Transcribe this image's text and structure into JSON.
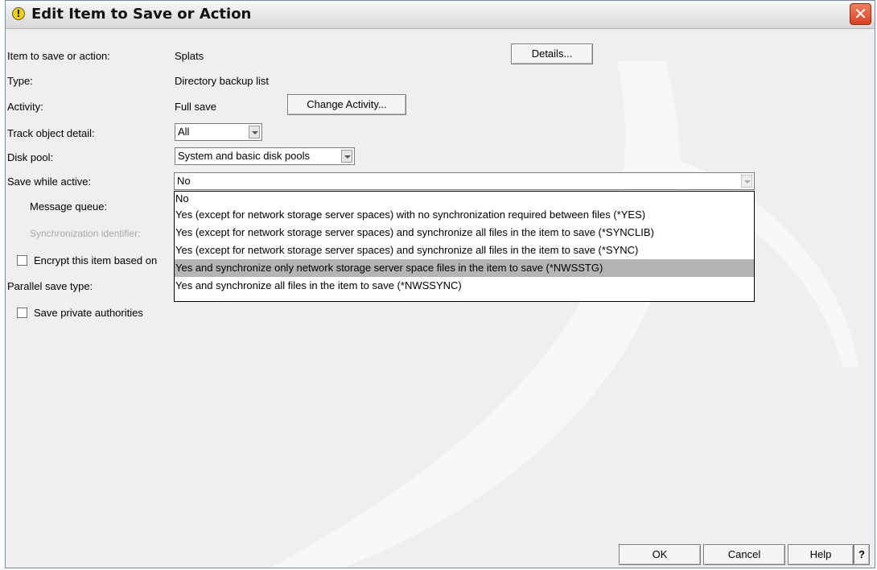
{
  "window": {
    "title": "Edit Item to Save or Action"
  },
  "fields": {
    "item_label": "Item to save or action:",
    "item_value": "Splats",
    "type_label": "Type:",
    "type_value": "Directory backup list",
    "activity_label": "Activity:",
    "activity_value": "Full save",
    "track_label": "Track object detail:",
    "track_value": "All",
    "disk_pool_label": "Disk pool:",
    "disk_pool_value": "System and basic disk pools",
    "swa_label": "Save while active:",
    "swa_value": "No",
    "msgq_label": "Message queue:",
    "sync_id_label": "Synchronization identifier:",
    "encrypt_label": "Encrypt this item based on",
    "parallel_label": "Parallel save type:",
    "private_auth_label": "Save private authorities"
  },
  "buttons": {
    "details": "Details...",
    "change_activity": "Change Activity...",
    "ok": "OK",
    "cancel": "Cancel",
    "help": "Help",
    "question": "?"
  },
  "swa_options": [
    "No",
    "Yes (except for network storage server spaces) with no synchronization required between files (*YES)",
    "Yes (except for network storage server spaces) and synchronize all files in the item to save (*SYNCLIB)",
    "Yes (except for network storage server spaces) and synchronize all files in the item to save (*SYNC)",
    "Yes and synchronize only network storage server space files in the item to save (*NWSSTG)",
    "Yes and synchronize all files in the item to save (*NWSSYNC)"
  ],
  "swa_highlighted": "Yes and synchronize only network storage server space files in the item to save (*NWSSTG)"
}
